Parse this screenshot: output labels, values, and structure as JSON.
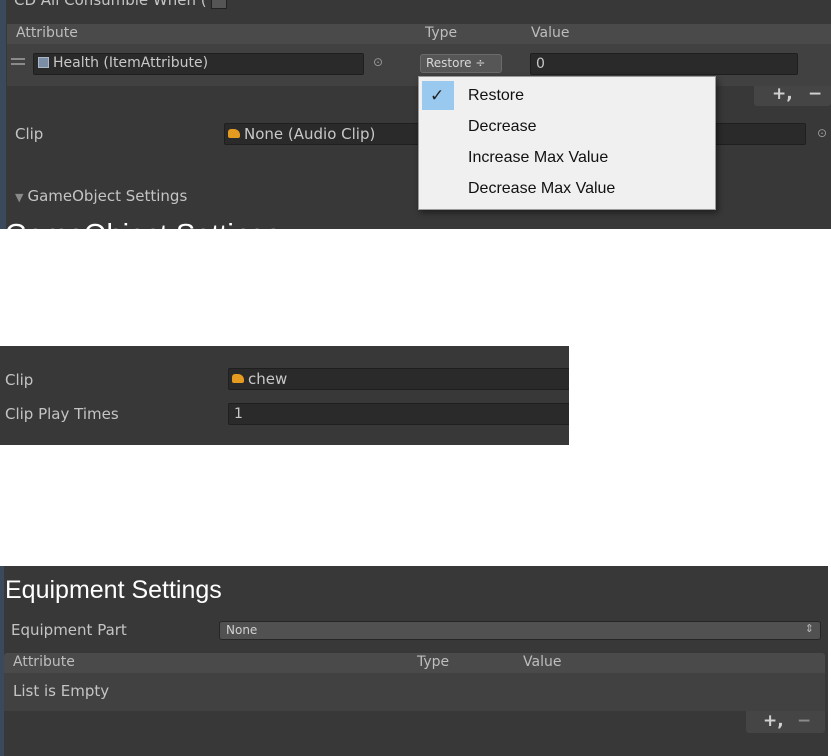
{
  "panel1": {
    "consumable_label": "CD All Consumble When (",
    "columns": {
      "attribute": "Attribute",
      "type": "Type",
      "value": "Value"
    },
    "row": {
      "attribute": "Health (ItemAttribute)",
      "type": "Restore ÷",
      "value": "0"
    },
    "add_symbol": "+,",
    "remove_symbol": "−",
    "clip_label": "Clip",
    "clip_value": "None (Audio Clip)",
    "foldout_label": "GameObject Settings",
    "section_title_partial": "GameObject Settings",
    "dropdown": {
      "items": [
        {
          "label": "Restore",
          "selected": true
        },
        {
          "label": "Decrease",
          "selected": false
        },
        {
          "label": "Increase Max Value",
          "selected": false
        },
        {
          "label": "Decrease Max Value",
          "selected": false
        }
      ]
    }
  },
  "panel2": {
    "clip_label": "Clip",
    "clip_value": "chew",
    "play_times_label": "Clip Play Times",
    "play_times_value": "1"
  },
  "panel3": {
    "title": "Equipment Settings",
    "part_label": "Equipment Part",
    "part_value": "None",
    "columns": {
      "attribute": "Attribute",
      "type": "Type",
      "value": "Value"
    },
    "empty_text": "List is Empty",
    "add_symbol": "+,",
    "remove_symbol": "−"
  },
  "colors": {
    "panel_bg": "#383838",
    "field_bg": "#2a2a2a",
    "header_bg": "#4a4a4a",
    "selection_blue": "#99c9ef",
    "dropdown_bg": "#f0f0f0",
    "clip_icon": "#e59b20"
  }
}
